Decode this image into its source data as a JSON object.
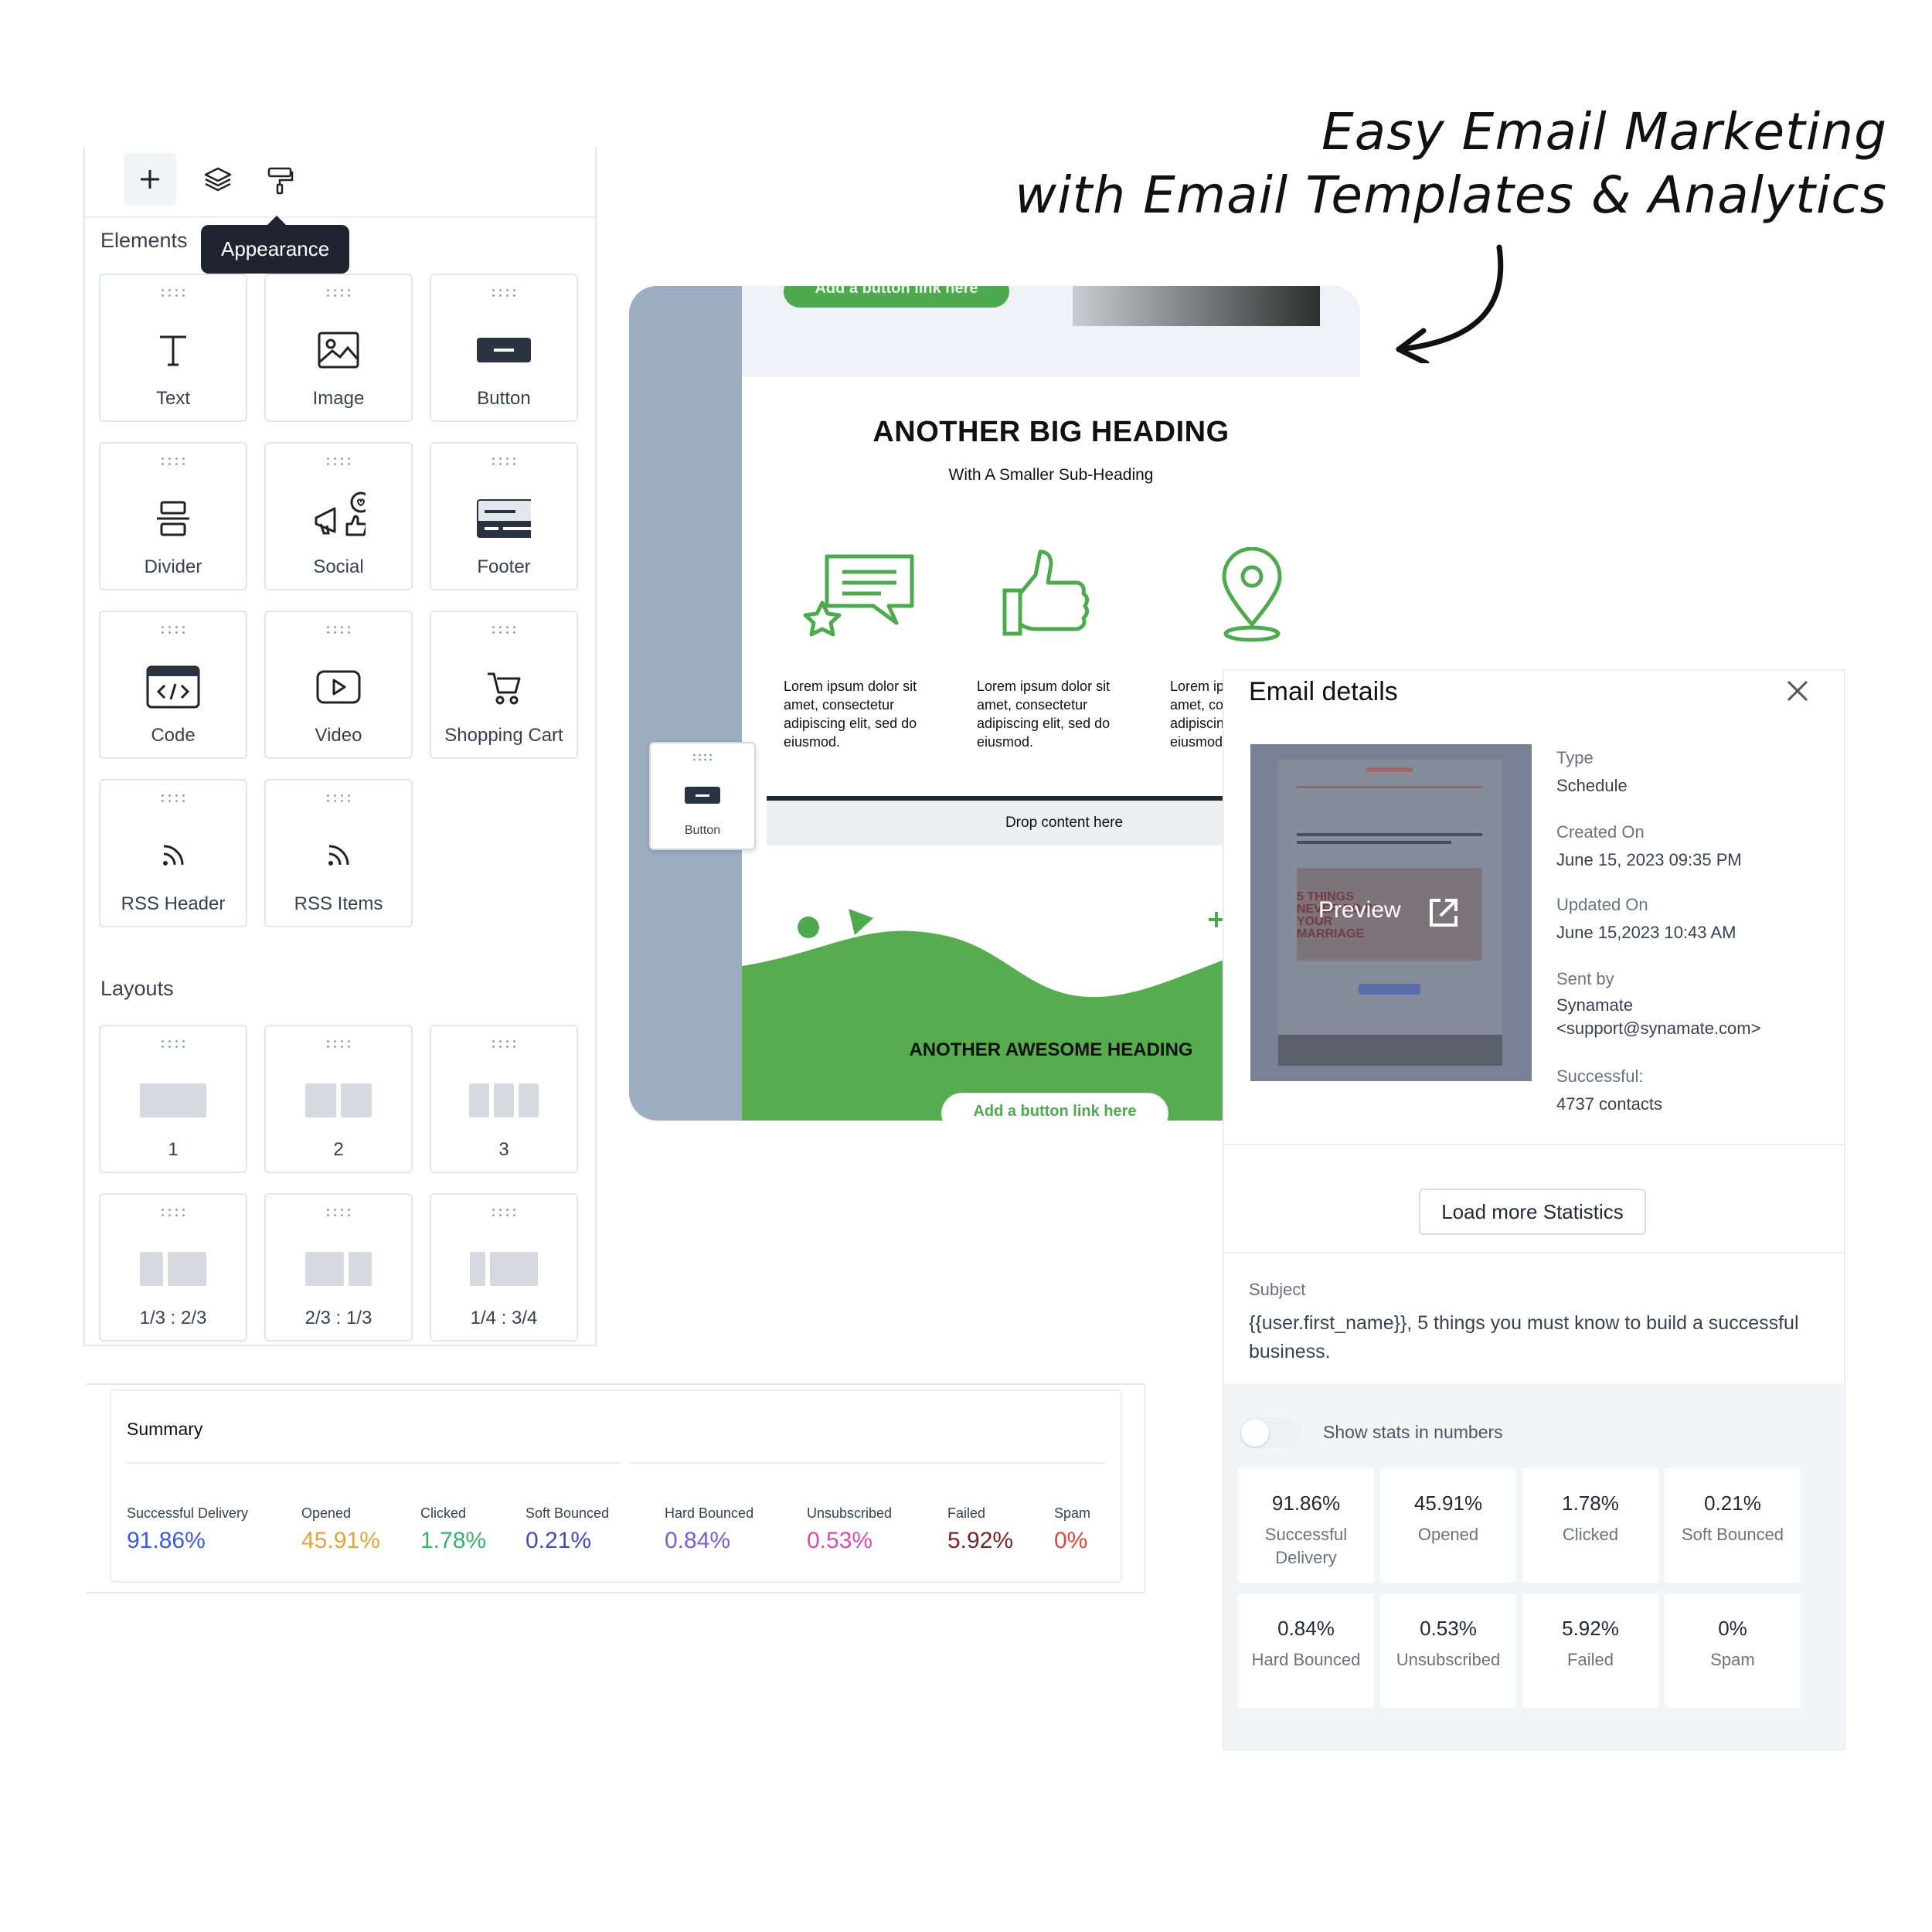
{
  "headline": {
    "line1": "Easy Email Marketing",
    "line2": "with Email Templates & Analytics"
  },
  "toolbar": {
    "tooltip": "Appearance"
  },
  "elements": {
    "title": "Elements",
    "items": [
      "Text",
      "Image",
      "Button",
      "Divider",
      "Social",
      "Footer",
      "Code",
      "Video",
      "Shopping Cart",
      "RSS Header",
      "RSS Items"
    ]
  },
  "layouts": {
    "title": "Layouts",
    "items": [
      "1",
      "2",
      "3",
      "1/3 : 2/3",
      "2/3 : 1/3",
      "1/4 : 3/4"
    ]
  },
  "email": {
    "top_button": "Add a button link here",
    "heading": "ANOTHER BIG HEADING",
    "subheading": "With A Smaller Sub-Heading",
    "col1": "Lorem ipsum dolor sit amet, consectetur adipiscing elit, sed do eiusmod.",
    "col2": "Lorem ipsum dolor sit amet, consectetur adipiscing elit, sed do eiusmod.",
    "col3": "Lorem ipsum dolor sit amet, consectetur adipiscing elit, sed do eiusmod.",
    "drag_label": "Button",
    "drop_label": "Drop content here",
    "awesome_heading": "ANOTHER AWESOME HEADING",
    "bottom_button": "Add a button link here",
    "accent": "#4eaa4e"
  },
  "details": {
    "title": "Email details",
    "preview_label": "Preview",
    "type_label": "Type",
    "type_value": "Schedule",
    "created_label": "Created On",
    "created_value": "June 15, 2023 09:35 PM",
    "updated_label": "Updated On",
    "updated_value": "June 15,2023 10:43 AM",
    "sent_label": "Sent by",
    "sent_name": "Synamate",
    "sent_email": "<support@synamate.com>",
    "success_label": "Successful:",
    "success_value": "4737 contacts",
    "load_more": "Load more Statistics",
    "subject_label": "Subject",
    "subject_value": "{{user.first_name}}, 5 things you must know to build a successful business.",
    "toggle_label": "Show stats in numbers",
    "stats": [
      {
        "value": "91.86%",
        "name": "Successful Delivery"
      },
      {
        "value": "45.91%",
        "name": "Opened"
      },
      {
        "value": "1.78%",
        "name": "Clicked"
      },
      {
        "value": "0.21%",
        "name": "Soft Bounced"
      },
      {
        "value": "0.84%",
        "name": "Hard Bounced"
      },
      {
        "value": "0.53%",
        "name": "Unsubscribed"
      },
      {
        "value": "5.92%",
        "name": "Failed"
      },
      {
        "value": "0%",
        "name": "Spam"
      }
    ]
  },
  "summary": {
    "title": "Summary",
    "metrics": [
      {
        "label": "Successful Delivery",
        "value": "91.86%",
        "color": "#3b5bdb"
      },
      {
        "label": "Opened",
        "value": "45.91%",
        "color": "#e8a23a"
      },
      {
        "label": "Clicked",
        "value": "1.78%",
        "color": "#37b26c"
      },
      {
        "label": "Soft Bounced",
        "value": "0.21%",
        "color": "#3d4db7"
      },
      {
        "label": "Hard Bounced",
        "value": "0.84%",
        "color": "#7b5bd6"
      },
      {
        "label": "Unsubscribed",
        "value": "0.53%",
        "color": "#d94bb0"
      },
      {
        "label": "Failed",
        "value": "5.92%",
        "color": "#7a2323"
      },
      {
        "label": "Spam",
        "value": "0%",
        "color": "#e0473a"
      }
    ]
  }
}
